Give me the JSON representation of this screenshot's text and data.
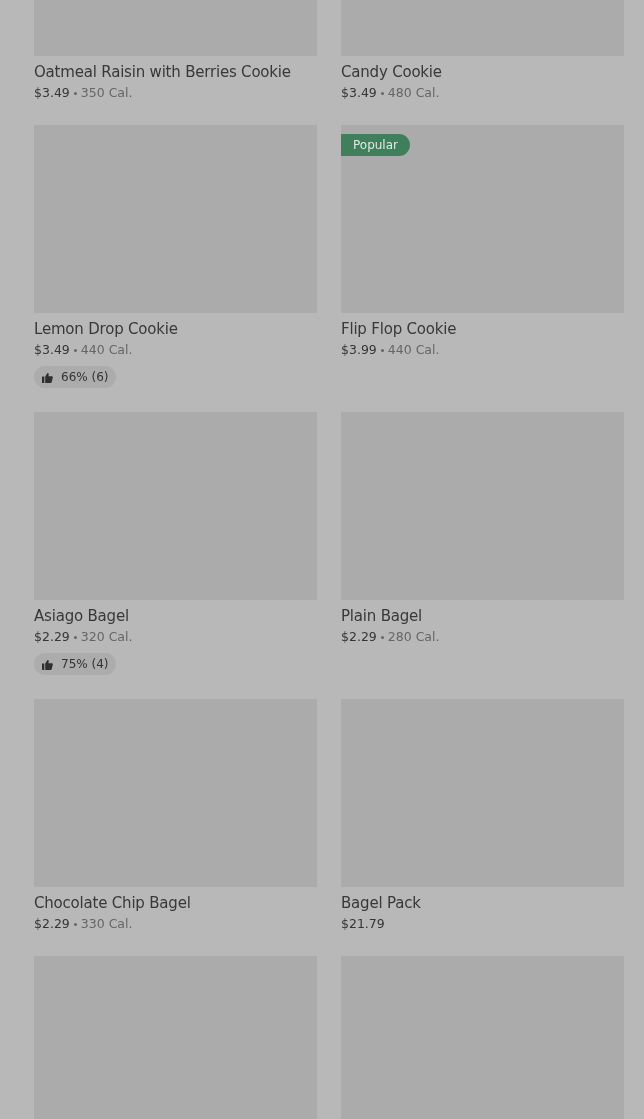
{
  "rows": [
    {
      "cards": [
        {
          "kind": "product",
          "name": "Oatmeal Raisin with Berries Cookie",
          "price": "$3.49",
          "calories": "350 Cal."
        },
        {
          "kind": "product",
          "name": "Candy Cookie",
          "price": "$3.49",
          "calories": "480 Cal."
        }
      ]
    },
    {
      "cards": [
        {
          "kind": "product",
          "name": "Lemon Drop Cookie",
          "price": "$3.49",
          "calories": "440 Cal.",
          "rating": "66% (6)"
        },
        {
          "kind": "product",
          "badge": "Popular",
          "name": "Flip Flop Cookie",
          "price": "$3.99",
          "calories": "440 Cal."
        }
      ]
    },
    {
      "cards": [
        {
          "kind": "product",
          "name": "Asiago Bagel",
          "price": "$2.29",
          "calories": "320 Cal.",
          "rating": "75% (4)"
        },
        {
          "kind": "product",
          "name": "Plain Bagel",
          "price": "$2.29",
          "calories": "280 Cal."
        }
      ]
    },
    {
      "cards": [
        {
          "kind": "product",
          "name": "Chocolate Chip Bagel",
          "price": "$2.29",
          "calories": "330 Cal."
        },
        {
          "kind": "product",
          "name": "Bagel Pack",
          "price": "$21.79"
        }
      ]
    },
    {
      "cards": [
        {
          "kind": "picture"
        },
        {
          "kind": "picture"
        }
      ]
    }
  ]
}
